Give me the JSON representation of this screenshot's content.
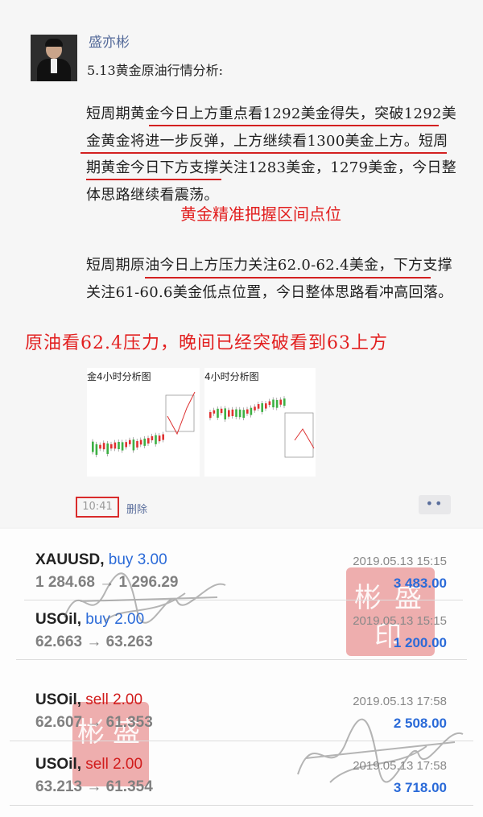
{
  "post": {
    "author": "盛亦彬",
    "subtitle": "5.13黄金原油行情分析:",
    "gold_paragraph": "短周期黄金今日上方重点看1292美金得失，突破1292美金黄金将进一步反弹，上方继续看1300美金上方。短周期黄金今日下方支撑关注1283美金，1279美金，今日整体思路继续看震荡。",
    "gold_annotation": "黄金精准把握区间点位",
    "oil_paragraph": "短周期原油今日上方压力关注62.0-62.4美金，下方支撑关注61-60.6美金低点位置，今日整体思路看冲高回落。",
    "oil_annotation": "原油看62.4压力，晚间已经突破看到63上方",
    "chart1_title": "金4小时分析图",
    "chart2_title": "4小时分析图",
    "time": "10:41",
    "delete_label": "删除",
    "more_label": "••"
  },
  "trades": [
    {
      "symbol": "XAUUSD,",
      "side": "buy 3.00",
      "side_type": "buy",
      "prices": "1 284.68 → 1 296.29",
      "date": "2019.05.13 15:15",
      "profit": "3 483.00"
    },
    {
      "symbol": "USOil,",
      "side": "buy 2.00",
      "side_type": "buy",
      "prices": "62.663 → 63.263",
      "date": "2019.05.13 15:15",
      "profit": "1 200.00"
    },
    {
      "symbol": "USOil,",
      "side": "sell 2.00",
      "side_type": "sell",
      "prices": "62.607 → 61.353",
      "date": "2019.05.13 17:58",
      "profit": "2 508.00"
    },
    {
      "symbol": "USOil,",
      "side": "sell 2.00",
      "side_type": "sell",
      "prices": "63.213 → 61.354",
      "date": "2019.05.13 17:58",
      "profit": "3 718.00"
    }
  ],
  "stamp": {
    "chars": [
      "彬",
      "盛",
      "印"
    ]
  },
  "colors": {
    "accent_red": "#d32020",
    "link_blue": "#5a6e9c",
    "buy_blue": "#2a6ad8",
    "sell_red": "#d11c1c"
  }
}
